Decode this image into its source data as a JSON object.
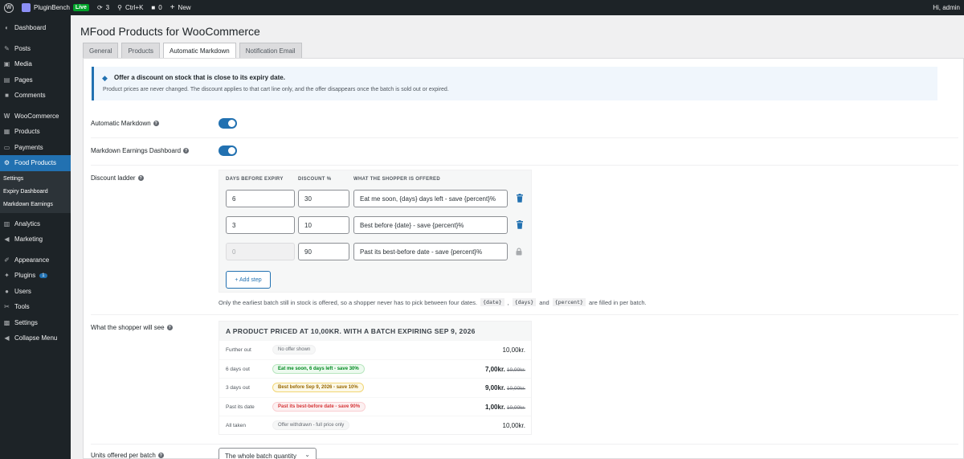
{
  "adminbar": {
    "site_name": "PluginBench",
    "live_label": "Live",
    "updates_count": "3",
    "search_label": "Ctrl+K",
    "comments_count": "0",
    "new_label": "New",
    "greeting": "Hi, admin"
  },
  "sidebar": {
    "items": [
      {
        "label": "Dashboard",
        "icon": "dashboard-icon"
      },
      {
        "label": "Posts",
        "icon": "pin-icon"
      },
      {
        "label": "Media",
        "icon": "media-icon"
      },
      {
        "label": "Pages",
        "icon": "page-icon"
      },
      {
        "label": "Comments",
        "icon": "comment-icon"
      },
      {
        "label": "WooCommerce",
        "icon": "woo-icon"
      },
      {
        "label": "Products",
        "icon": "products-icon"
      },
      {
        "label": "Payments",
        "icon": "payments-icon"
      },
      {
        "label": "Food Products",
        "icon": "gear-icon"
      },
      {
        "label": "Analytics",
        "icon": "analytics-icon"
      },
      {
        "label": "Marketing",
        "icon": "megaphone-icon"
      },
      {
        "label": "Appearance",
        "icon": "brush-icon"
      },
      {
        "label": "Plugins",
        "icon": "plugin-icon",
        "badge": "1"
      },
      {
        "label": "Users",
        "icon": "users-icon"
      },
      {
        "label": "Tools",
        "icon": "wrench-icon"
      },
      {
        "label": "Settings",
        "icon": "settings-icon"
      },
      {
        "label": "Collapse Menu",
        "icon": "collapse-icon"
      }
    ],
    "submenu": [
      "Settings",
      "Expiry Dashboard",
      "Markdown Earnings"
    ]
  },
  "page": {
    "title": "MFood Products for WooCommerce",
    "tabs": [
      "General",
      "Products",
      "Automatic Markdown",
      "Notification Email"
    ],
    "active_tab": "Automatic Markdown"
  },
  "notice": {
    "title": "Offer a discount on stock that is close to its expiry date.",
    "text": "Product prices are never changed. The discount applies to that cart line only, and the offer disappears once the batch is sold out or expired."
  },
  "settings": {
    "automatic_markdown_label": "Automatic Markdown",
    "automatic_markdown_on": true,
    "earnings_dashboard_label": "Markdown Earnings Dashboard",
    "earnings_dashboard_on": true,
    "discount_ladder_label": "Discount ladder",
    "shopper_preview_label": "What the shopper will see",
    "units_label": "Units offered per batch"
  },
  "ladder": {
    "headers": [
      "DAYS BEFORE EXPIRY",
      "DISCOUNT %",
      "WHAT THE SHOPPER IS OFFERED"
    ],
    "rows": [
      {
        "days": "6",
        "discount": "30",
        "message": "Eat me soon, {days} days left - save {percent}%",
        "action": "trash-icon"
      },
      {
        "days": "3",
        "discount": "10",
        "message": "Best before {date} - save {percent}%",
        "action": "trash-icon"
      },
      {
        "days": "0",
        "discount": "90",
        "message": "Past its best-before date - save {percent}%",
        "action": "lock-icon",
        "disabled": true
      }
    ],
    "add_step_label": "+ Add step",
    "note_prefix": "Only the earliest batch still in stock is offered, so a shopper never has to pick between four dates.",
    "note_tokens": [
      "{date}",
      "{days}",
      "{percent}"
    ],
    "note_sep1": ",",
    "note_sep2": "and",
    "note_suffix": "are filled in per batch."
  },
  "preview": {
    "heading": "A PRODUCT PRICED AT 10,00KR. WITH A BATCH EXPIRING SEP 9, 2026",
    "rows": [
      {
        "when": "Further out",
        "pill": "No offer shown",
        "tone": "neutral",
        "price": "10,00kr.",
        "old": ""
      },
      {
        "when": "6 days out",
        "pill": "Eat me soon, 6 days left - save 30%",
        "tone": "green",
        "price": "7,00kr.",
        "old": "10,00kr."
      },
      {
        "when": "3 days out",
        "pill": "Best before Sep 9, 2026 - save 10%",
        "tone": "amber",
        "price": "9,00kr.",
        "old": "10,00kr."
      },
      {
        "when": "Past its date",
        "pill": "Past its best-before date - save 90%",
        "tone": "red",
        "price": "1,00kr.",
        "old": "10,00kr."
      },
      {
        "when": "All taken",
        "pill": "Offer withdrawn - full price only",
        "tone": "neutral",
        "price": "10,00kr.",
        "old": ""
      }
    ]
  },
  "units_select": {
    "value": "The whole batch quantity"
  }
}
